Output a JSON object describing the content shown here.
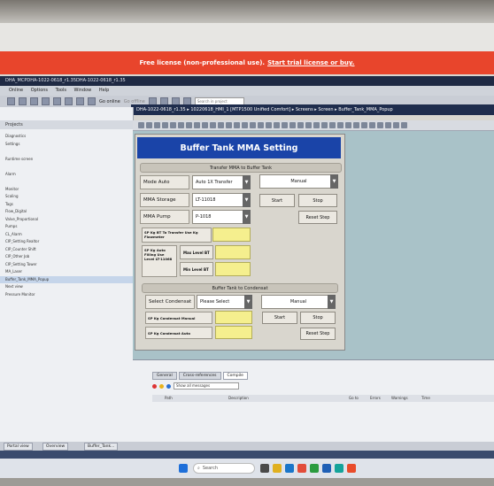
{
  "license_banner": {
    "text": "Free license (non-professional use).",
    "link": "Start trial license or buy."
  },
  "app_title": "DHA_MCPDHA-1022-0618_r1.35DHA-1022-0618_r1.35",
  "menu": [
    "Online",
    "Options",
    "Tools",
    "Window",
    "Help"
  ],
  "toolbar": {
    "go_online": "Go online",
    "go_offline": "Go offline",
    "search_placeholder": "Search in project"
  },
  "breadcrumb": "DHA-1022-0618_r1.35 ▸ 10220618_HMI_1 [MTP1500 Unified Comfort] ▸ Screens ▸ Screen ▸ Buffer_Tank_MMA_Popup",
  "left_panel": {
    "header": "Projects",
    "items": [
      "Diagnostics",
      "Settings",
      "",
      "Runtime screen",
      "",
      "Alarm",
      "",
      "Monitor",
      "Scaling",
      "Tags",
      "Flow_Digital",
      "Valve_Proportional",
      "Pumps",
      "CL_Alarm",
      "CIP_Setting Realtor",
      "CIP_Counter Shift",
      "CIP_Other Job",
      "CIP_Setting Tower",
      "MA_Laser",
      "Buffer_Tank_MMA_Popup",
      "Next view",
      "Pressure Monitor"
    ],
    "selected_index": 19
  },
  "hmi": {
    "title": "Buffer Tank MMA Setting",
    "section1": "Transfer MMA to Buffer Tank",
    "mode_auto": {
      "label": "Mode Auto",
      "value": "Auto 1X Transfer"
    },
    "manual1": "Manual",
    "mma_storage": {
      "label": "MMA Storage",
      "value": "LT-11018"
    },
    "mma_pump": {
      "label": "MMA Pump",
      "value": "P-1018"
    },
    "start1": "Start",
    "stop1": "Stop",
    "reset1": "Reset Step",
    "sp_flowmeter": "SP Kg BT To Transfer Use Kg Flowmeter",
    "sp_auto_filling": "SP Kg Auto Filling Use Level LT-11068",
    "max_level": "Max Level BT",
    "min_level": "Min Level BT",
    "section2": "Buffer Tank to Condensat",
    "select_condensat": {
      "label": "Select Condensat",
      "value": "Please Select"
    },
    "manual2": "Manual",
    "start2": "Start",
    "stop2": "Stop",
    "reset2": "Reset Step",
    "sp_condensat_manual": "SP Kg Condensat Manual",
    "sp_condensat_auto": "SP Kg Condensat Auto"
  },
  "output": {
    "tabs": [
      "General",
      "Cross-references",
      "Compile"
    ],
    "filter": "Show all messages",
    "columns": [
      "Path",
      "Description",
      "Go to",
      "Errors",
      "Warnings",
      "Time"
    ]
  },
  "status_tabs": [
    "Portal view",
    "Overview",
    "Buffer_Tank..."
  ],
  "taskbar": {
    "search": "Search"
  }
}
